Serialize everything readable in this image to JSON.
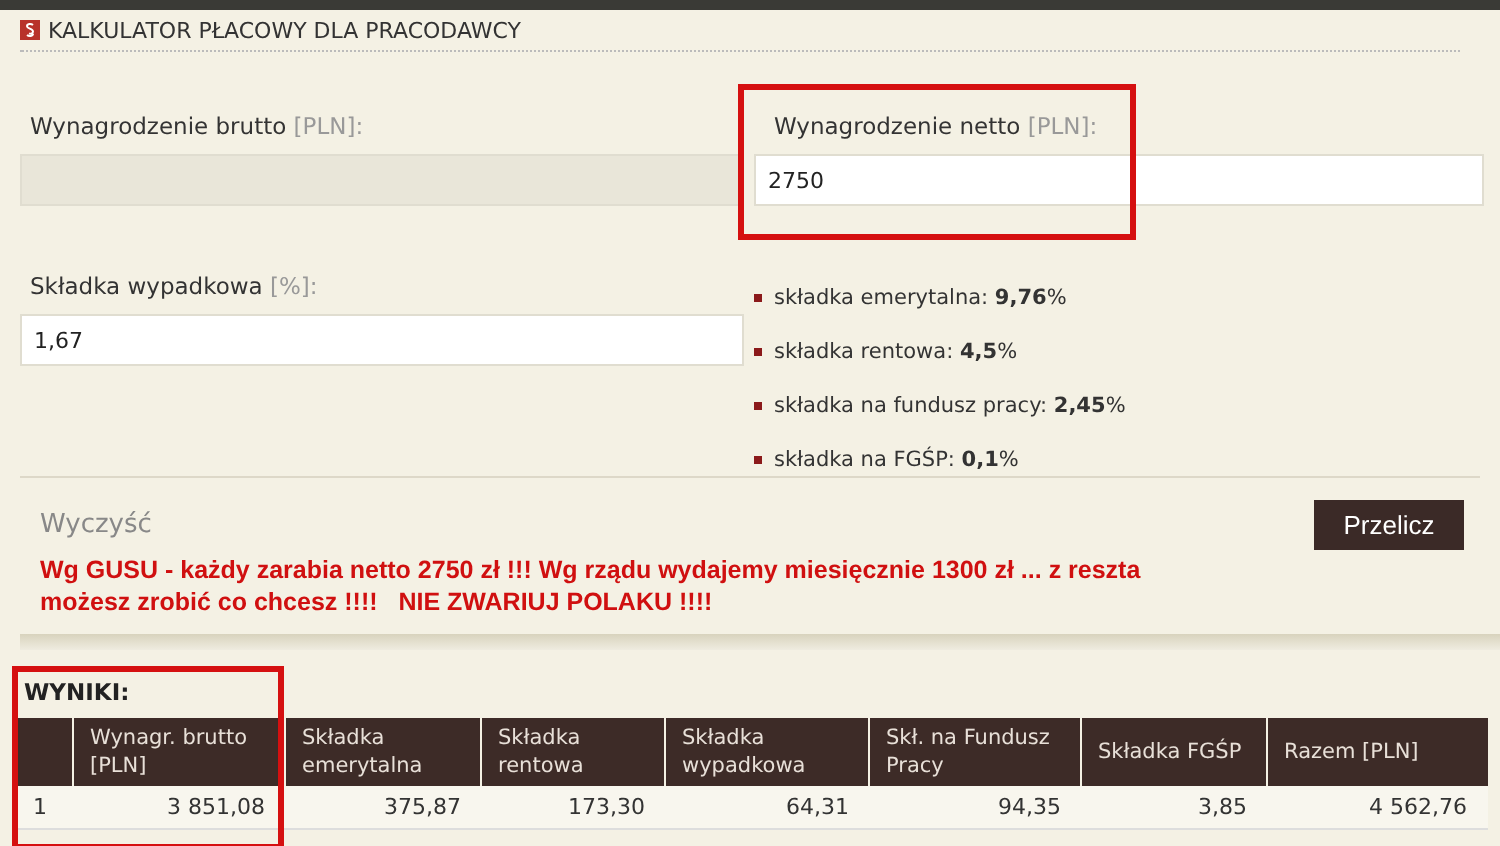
{
  "title": "KALKULATOR PŁACOWY DLA PRACODAWCY",
  "gross_field": {
    "label": "Wynagrodzenie brutto",
    "unit": "[PLN]:",
    "disabled": true
  },
  "net_field": {
    "label": "Wynagrodzenie netto",
    "unit": "[PLN]:",
    "value": "2750",
    "highlighted": true
  },
  "accident_field": {
    "label": "Składka wypadkowa",
    "unit": "[%]:",
    "value": "1,67"
  },
  "rates": [
    {
      "text": "składka emerytalna: **9,76**%"
    },
    {
      "text": "składka rentowa: **4,5**%"
    },
    {
      "text": "składka na fundusz pracy: **2,45**%"
    },
    {
      "text": "składka na FGŚP: **0,1**%"
    }
  ],
  "clear_link": "Wyczyść",
  "calculate_button": "Przelicz",
  "message": "Wg GUSU - każdy zarabia netto 2750 zł !!! Wg rządu wydajemy miesięcznie 1300 zł ... z reszta możesz zrobić co chcesz !!!!   NIE ZWARIUJ POLAKU !!!!",
  "results": {
    "title": "WYNIKI:",
    "highlighted": true,
    "columns": [
      "",
      "Wynagr. brutto [PLN]",
      "Składka emerytalna",
      "Składka rentowa",
      "Składka wypadkowa",
      "Skł. na Fundusz Pracy",
      "Składka FGŚP",
      "Razem [PLN]"
    ],
    "rows": [
      [
        "1",
        "3 851,08",
        "375,87",
        "173,30",
        "64,31",
        "94,35",
        "3,85",
        "4 562,76"
      ]
    ]
  }
}
